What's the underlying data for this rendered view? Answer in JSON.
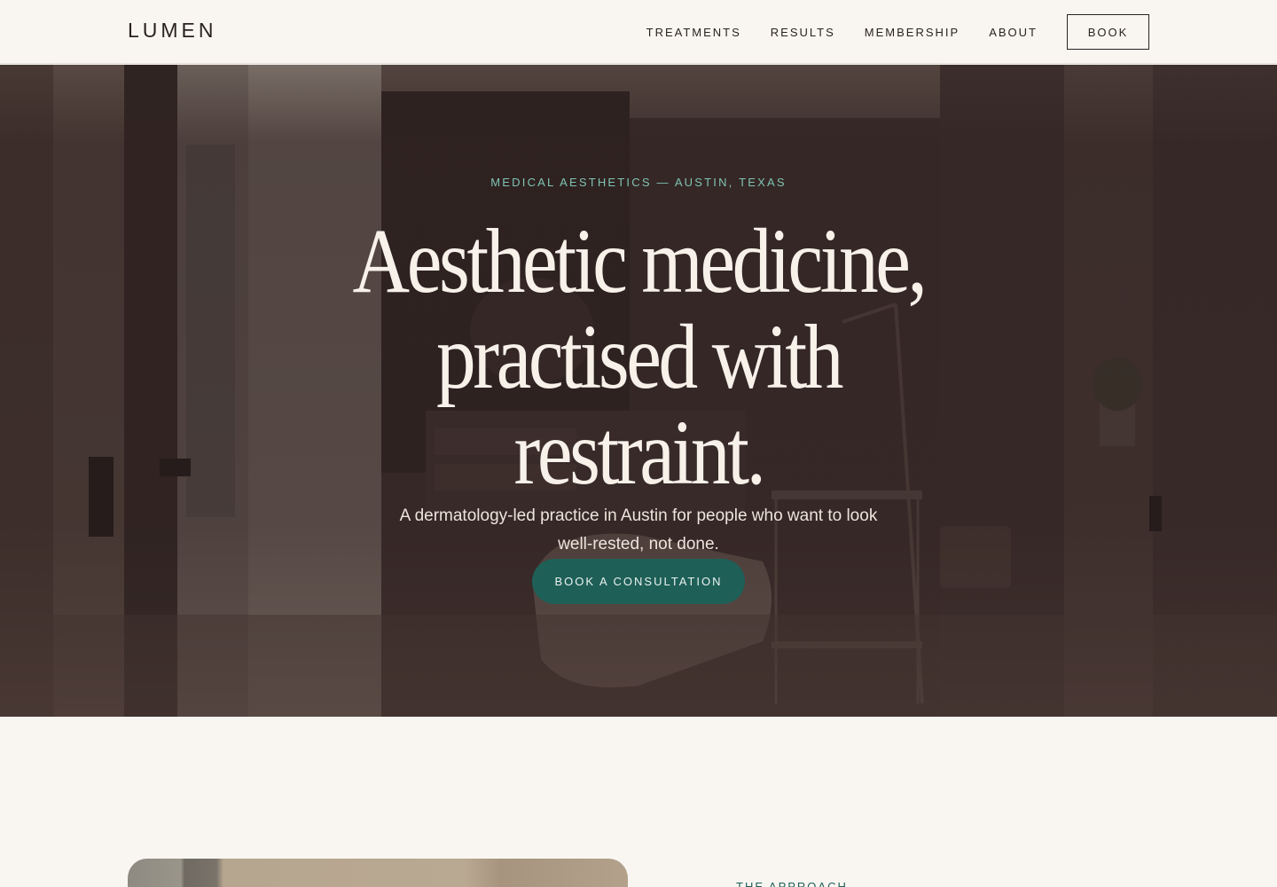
{
  "header": {
    "logo": "LUMEN",
    "nav": [
      {
        "label": "TREATMENTS"
      },
      {
        "label": "RESULTS"
      },
      {
        "label": "MEMBERSHIP"
      },
      {
        "label": "ABOUT"
      }
    ],
    "book_label": "BOOK"
  },
  "hero": {
    "eyebrow": "MEDICAL AESTHETICS — AUSTIN, TEXAS",
    "headline_lines": [
      "Aesthetic medicine,",
      "practised with",
      "restraint."
    ],
    "subhead": "A dermatology-led practice in Austin for people who want to look well-rested, not done.",
    "cta_label": "BOOK A CONSULTATION"
  },
  "approach": {
    "label": "THE APPROACH"
  },
  "colors": {
    "background": "#f9f6f2",
    "accent": "#1e5f57",
    "eyebrow": "#7fc3b3",
    "hero_text": "#f7f1ea"
  }
}
